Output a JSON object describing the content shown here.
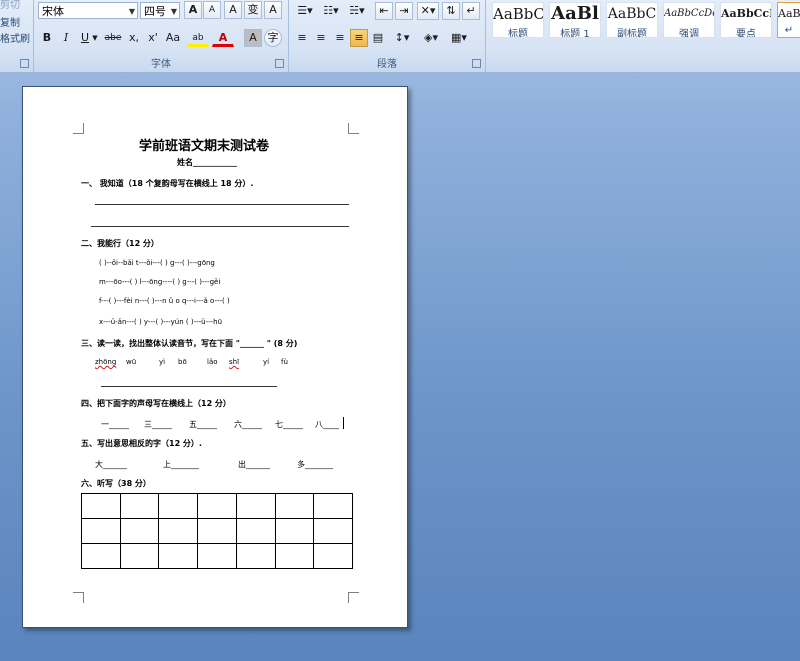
{
  "clipboard": {
    "items": [
      "剪切",
      "复制",
      "格式刷"
    ]
  },
  "font_group": {
    "label": "字体",
    "font_name": "宋体",
    "font_size": "四号",
    "grow_label": "A",
    "shrink_label": "A",
    "clear_label": "A",
    "phonetic_label": "变",
    "border_label": "A",
    "bold_label": "B",
    "italic_label": "I",
    "underline_label": "U",
    "strike_label": "abe",
    "sub_label": "x,",
    "sup_label": "x'",
    "case_label": "Aa",
    "highlight_label": "ab",
    "color_label": "A",
    "shade_label": "A",
    "circle_label": "字"
  },
  "paragraph_group": {
    "label": "段落"
  },
  "styles_group": {
    "items": [
      {
        "sample": "AaBbC",
        "name": "标题"
      },
      {
        "sample": "AaBl",
        "name": "标题 1"
      },
      {
        "sample": "AaBbC",
        "name": "副标题"
      },
      {
        "sample": "AaBbCcDc",
        "name": "强调"
      },
      {
        "sample": "AaBbCcD",
        "name": "要点"
      },
      {
        "sample": "AaB",
        "name": "↵"
      }
    ]
  },
  "document": {
    "title": "学前班语文期末测试卷",
    "name_field": "姓名___________",
    "q1": "一、 我知道（18 个复韵母写在横线上 18 分）.",
    "q2": "二、我能行（12 分）",
    "q2_rows": [
      "(        )--ǒi--bǎi        t---ǒi---(        )        g---(        )---gōng",
      "m---ōo---(        )        l---ōng----(        )        g---(        )---gěi",
      "f---(        )---fèi        n---(        )---n ǔ o        q---i---ǎ o---(        )",
      "x---ü-ǎn---(        )        y---(        )---yún        (        )---ü---hū"
    ],
    "q3": "三、读一读，找出整体认读音节，写在下面 \"______ \" (8 分)",
    "q3_pinyin": [
      "zhōng",
      "wū",
      "yì",
      "bō",
      "lǎo",
      "shī",
      "yí",
      "fù"
    ],
    "q4": "四、把下面字的声母写在横线上（12 分）",
    "q4_items": [
      "一_____",
      "三_____",
      "五_____",
      "六_____",
      "七_____",
      "八____"
    ],
    "q5": "五、写出意思相反的字（12 分）.",
    "q5_items": [
      "大______",
      "上_______",
      "出______",
      "多_______"
    ],
    "q6": "六、听写（38 分）"
  }
}
